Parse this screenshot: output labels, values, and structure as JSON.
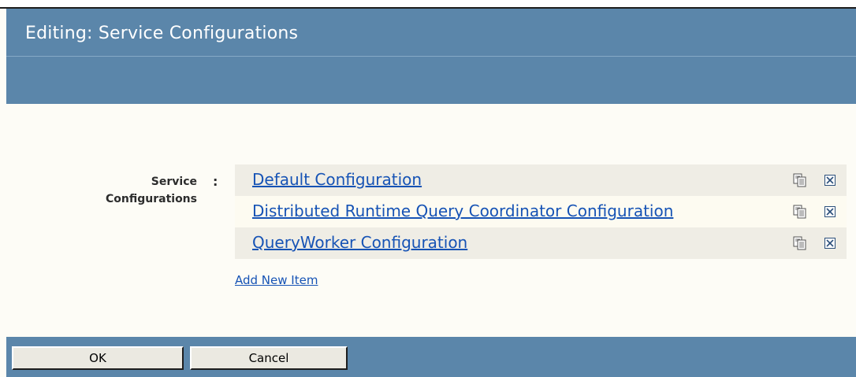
{
  "dialog": {
    "title": "Editing: Service Configurations"
  },
  "field": {
    "label_line1": "Service",
    "label_line2": "Configurations",
    "colon": ":"
  },
  "items": [
    {
      "label": "Default Configuration",
      "copy_icon": "copy-icon",
      "delete_icon": "delete-icon"
    },
    {
      "label": "Distributed Runtime Query Coordinator Configuration",
      "copy_icon": "copy-icon",
      "delete_icon": "delete-icon"
    },
    {
      "label": "QueryWorker Configuration",
      "copy_icon": "copy-icon",
      "delete_icon": "delete-icon"
    }
  ],
  "add_new_label": "Add New Item",
  "footer": {
    "ok_label": "OK",
    "cancel_label": "Cancel"
  },
  "colors": {
    "header_blue": "#5b86aa",
    "link_blue": "#1653b5",
    "content_bg": "#fdfcf6",
    "row_odd": "#efede5",
    "row_even": "#fdfbf1"
  }
}
